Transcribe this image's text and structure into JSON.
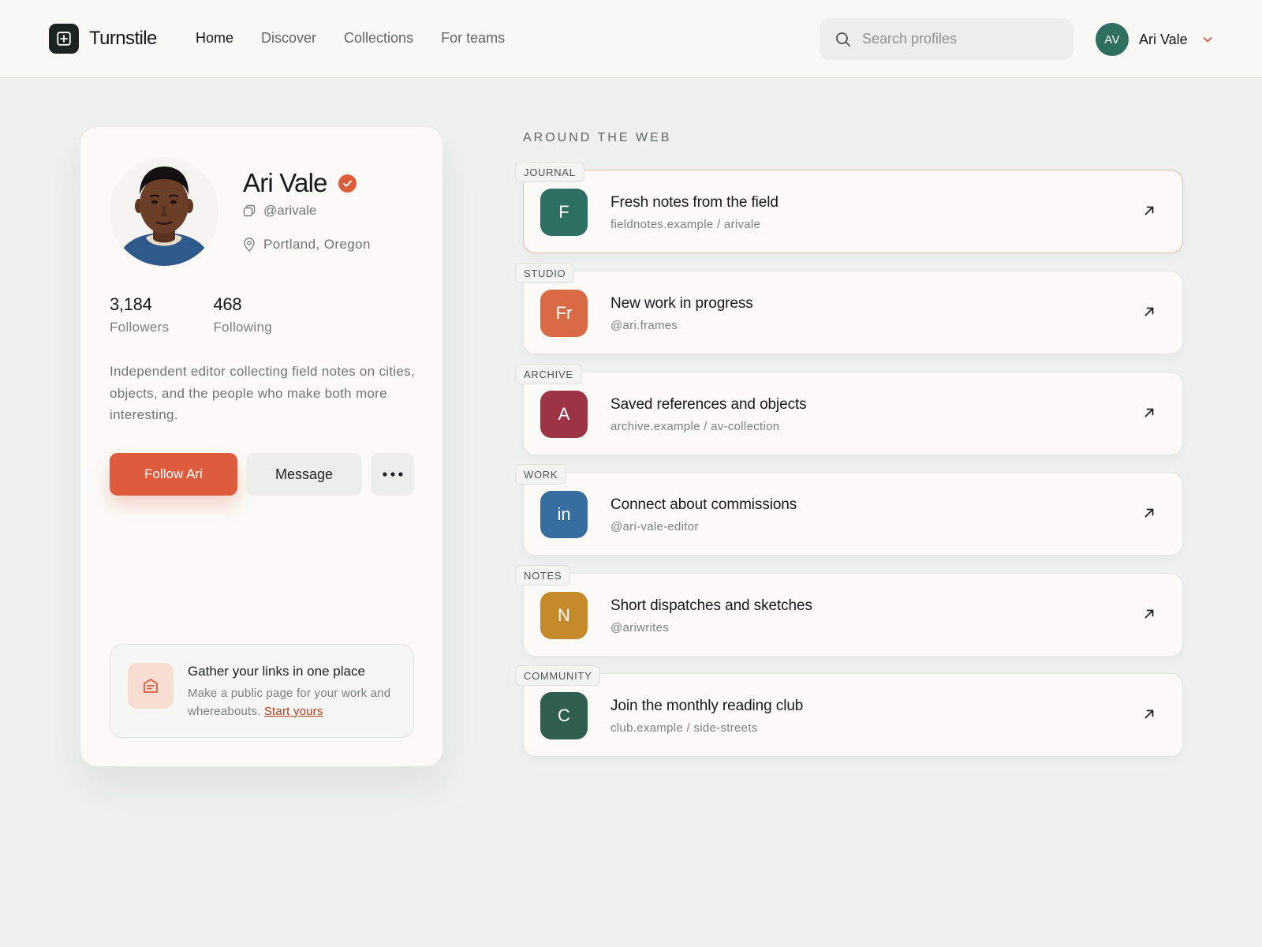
{
  "app": {
    "name": "Turnstile"
  },
  "nav": [
    {
      "label": "Home",
      "active": true
    },
    {
      "label": "Discover",
      "active": false
    },
    {
      "label": "Collections",
      "active": false
    },
    {
      "label": "For teams",
      "active": false
    }
  ],
  "search": {
    "placeholder": "Search profiles"
  },
  "user": {
    "initials": "AV",
    "name": "Ari Vale",
    "avatar_color": "#2f6f5f"
  },
  "profile": {
    "name": "Ari Vale",
    "handle": "@arivale",
    "location": "Portland, Oregon",
    "stats": [
      {
        "value": "3,184",
        "label": "Followers"
      },
      {
        "value": "468",
        "label": "Following"
      }
    ],
    "bio": "Independent editor collecting field notes on cities, objects, and the people who make both more interesting.",
    "follow_label": "Follow Ari",
    "message_label": "Message",
    "accent_color": "#dc5c3d"
  },
  "promo": {
    "title": "Gather your links in one place",
    "desc": "Make a public page for your work and whereabouts.",
    "link": "Start yours"
  },
  "links_section": {
    "title": "AROUND THE WEB",
    "items": [
      {
        "tag": "JOURNAL",
        "initial": "F",
        "color": "#2e6f63",
        "title": "Fresh notes from the field",
        "sub": "fieldnotes.example / arivale",
        "highlight": true
      },
      {
        "tag": "STUDIO",
        "initial": "Fr",
        "color": "#d86a46",
        "title": "New work in progress",
        "sub": "@ari.frames",
        "highlight": false
      },
      {
        "tag": "ARCHIVE",
        "initial": "A",
        "color": "#9c3446",
        "title": "Saved references and objects",
        "sub": "archive.example / av-collection",
        "highlight": false
      },
      {
        "tag": "WORK",
        "initial": "in",
        "color": "#386da0",
        "title": "Connect about commissions",
        "sub": "@ari-vale-editor",
        "highlight": false
      },
      {
        "tag": "NOTES",
        "initial": "N",
        "color": "#c48a2c",
        "title": "Short dispatches and sketches",
        "sub": "@ariwrites",
        "highlight": false
      },
      {
        "tag": "COMMUNITY",
        "initial": "C",
        "color": "#2e5f4c",
        "title": "Join the monthly reading club",
        "sub": "club.example / side-streets",
        "highlight": false
      }
    ]
  }
}
